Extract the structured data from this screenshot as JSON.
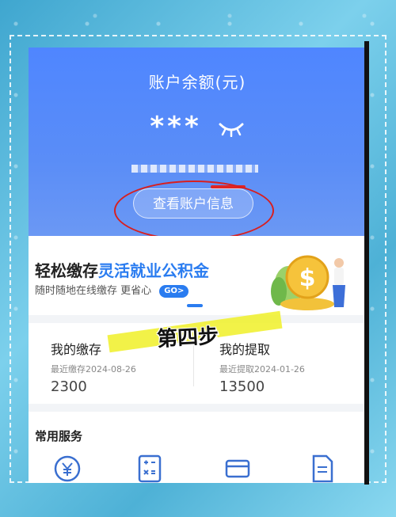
{
  "header": {
    "balance_title": "账户余额(元)",
    "balance_value": "***",
    "view_account_button": "查看账户信息"
  },
  "banner": {
    "title_part1": "轻松缴存",
    "title_part2": "灵活就业公积金",
    "subtitle": "随时随地在线缴存 更省心",
    "go_label": "GO>"
  },
  "stats": {
    "deposit": {
      "label": "我的缴存",
      "date_text": "最近缴存2024-08-26",
      "amount": "2300"
    },
    "withdraw": {
      "label": "我的提取",
      "date_text": "最近提取2024-01-26",
      "amount": "13500"
    }
  },
  "annotation": {
    "step_text": "第四步"
  },
  "services": {
    "title": "常用服务"
  },
  "colors": {
    "accent": "#4f86ff",
    "banner_blue": "#2a7cf0",
    "highlight": "#f0f028",
    "annotation_red": "#d81f1f"
  },
  "icons": [
    "eye-closed-icon",
    "yuan-coin-icon",
    "calculator-icon",
    "card-icon",
    "document-icon",
    "coin-illustration"
  ]
}
